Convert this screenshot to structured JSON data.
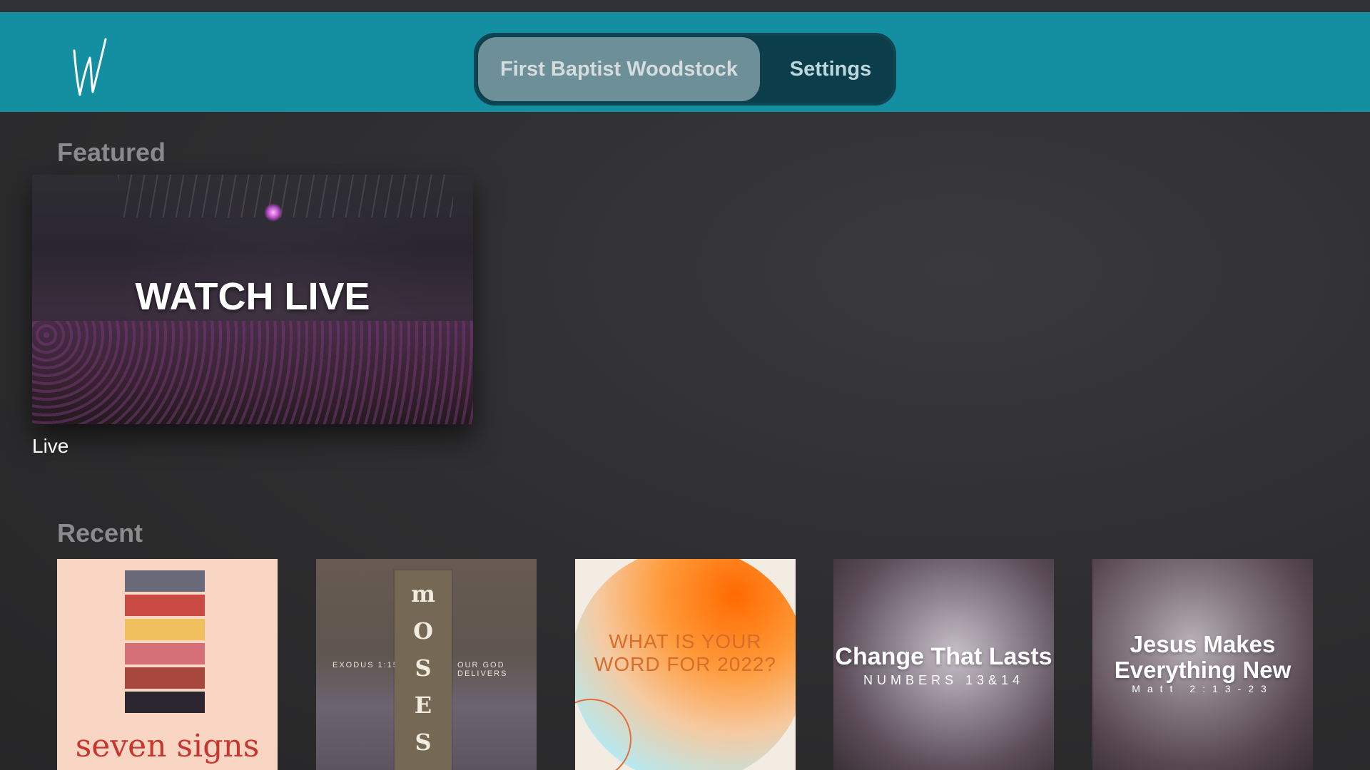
{
  "header": {
    "tabs": [
      {
        "label": "First Baptist Woodstock",
        "selected": true
      },
      {
        "label": "Settings",
        "selected": false
      }
    ],
    "accent": "#148ea1"
  },
  "featured": {
    "section_title": "Featured",
    "card": {
      "image_text": "WATCH LIVE",
      "label": "Live"
    }
  },
  "recent": {
    "section_title": "Recent",
    "tiles": [
      {
        "text": "seven signs"
      },
      {
        "letters": [
          "m",
          "O",
          "S",
          "E",
          "S"
        ],
        "left_text": "EXODUS 1:15",
        "right_text": "OUR GOD DELIVERS"
      },
      {
        "text": "WHAT IS YOUR WORD FOR 2022?"
      },
      {
        "title": "Change That Lasts",
        "subtitle": "NUMBERS 13&14"
      },
      {
        "title": "Jesus Makes Everything New",
        "subtitle": "Matt 2:13-23"
      }
    ]
  }
}
